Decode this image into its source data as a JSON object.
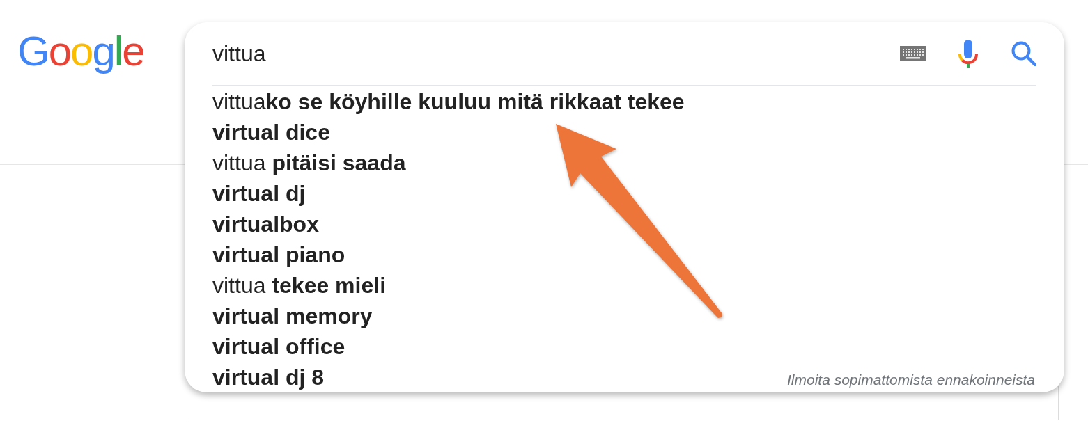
{
  "logo": {
    "text": "Google"
  },
  "search": {
    "value": "vittua"
  },
  "suggestions": [
    {
      "text": "vittua**ko se köyhille kuuluu mitä rikkaat tekee**",
      "bold": false,
      "selected": false
    },
    {
      "text": "virtual dice",
      "bold": true,
      "selected": false
    },
    {
      "text": "vittua **pitäisi saada**",
      "bold": false,
      "selected": false
    },
    {
      "text": "virtual dj",
      "bold": true,
      "selected": false
    },
    {
      "text": "virtualbox",
      "bold": true,
      "selected": false
    },
    {
      "text": "virtual piano",
      "bold": true,
      "selected": false
    },
    {
      "text": "vittua **tekee mieli**",
      "bold": false,
      "selected": false
    },
    {
      "text": "virtual memory",
      "bold": true,
      "selected": false
    },
    {
      "text": "virtual office",
      "bold": true,
      "selected": false
    },
    {
      "text": "virtual dj 8",
      "bold": true,
      "selected": false
    }
  ],
  "report_link": "Ilmoita sopimattomista ennakoinneista"
}
